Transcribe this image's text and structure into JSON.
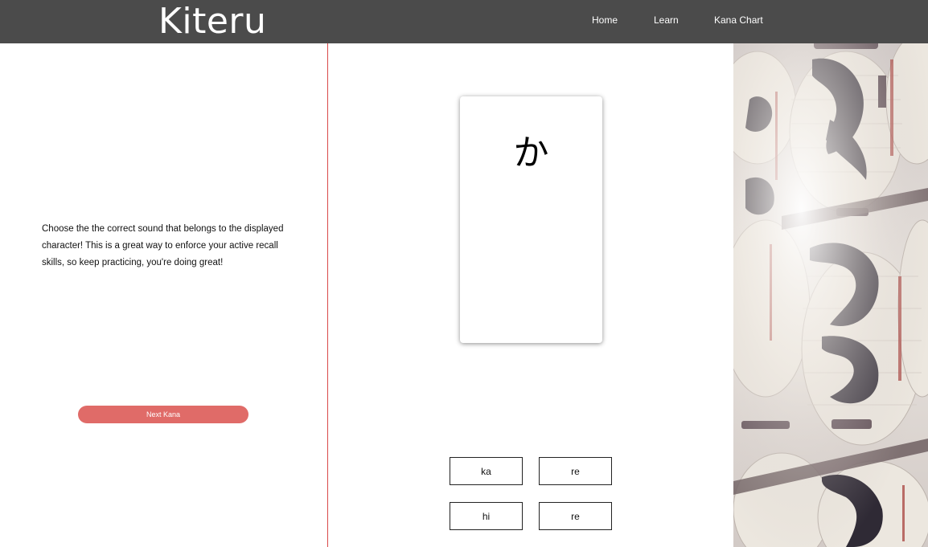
{
  "app": {
    "logo": "Kiteru"
  },
  "nav": {
    "home": "Home",
    "learn": "Learn",
    "kana_chart": "Kana Chart"
  },
  "left": {
    "instructions": "Choose the the correct sound that belongs to the displayed character! This is a great way to enforce your active recall skills, so keep practicing, you're doing great!",
    "next_button": "Next Kana"
  },
  "card": {
    "kana": "か"
  },
  "answers": [
    "ka",
    "re",
    "hi",
    "re"
  ],
  "colors": {
    "navbar": "#4b4b4b",
    "accent": "#e06b68",
    "divider": "#d94a4a"
  },
  "images": {
    "side_photo": "paper-lanterns-photo"
  }
}
